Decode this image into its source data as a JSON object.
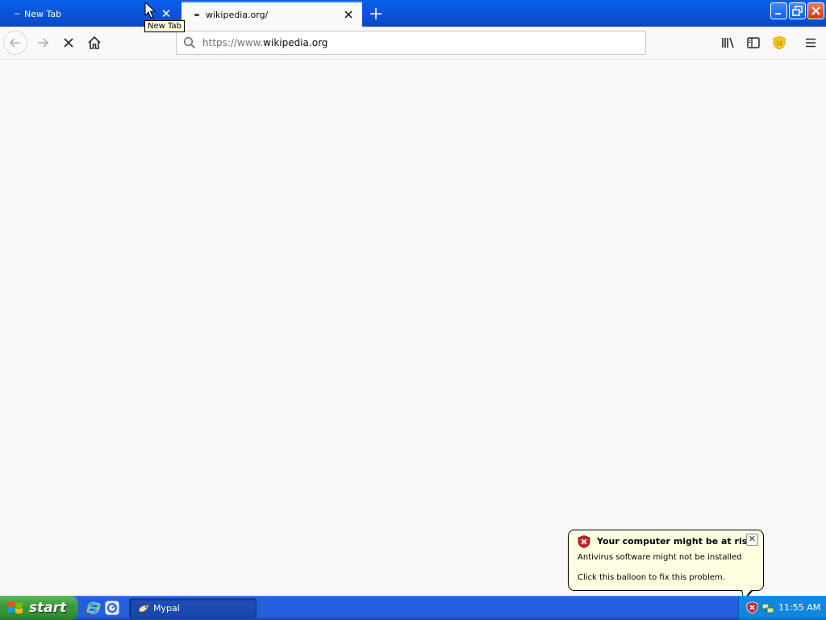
{
  "tabs": [
    {
      "label": "New Tab",
      "active": false
    },
    {
      "label": "wikipedia.org/",
      "active": true
    }
  ],
  "tooltip": {
    "text": "New Tab"
  },
  "urlbar": {
    "prefix": "https://www.",
    "domain": "wikipedia.org"
  },
  "balloon": {
    "title": "Your computer might be at risk",
    "line1": "Antivirus software might not be installed",
    "line2": "Click this balloon to fix this problem."
  },
  "taskbar": {
    "start_label": "start",
    "window_label": "Mypal",
    "clock": "11:55 AM"
  },
  "colors": {
    "accent": "#0a84ff",
    "xp_blue": "#245edb",
    "start_green": "#3c9b3c"
  }
}
